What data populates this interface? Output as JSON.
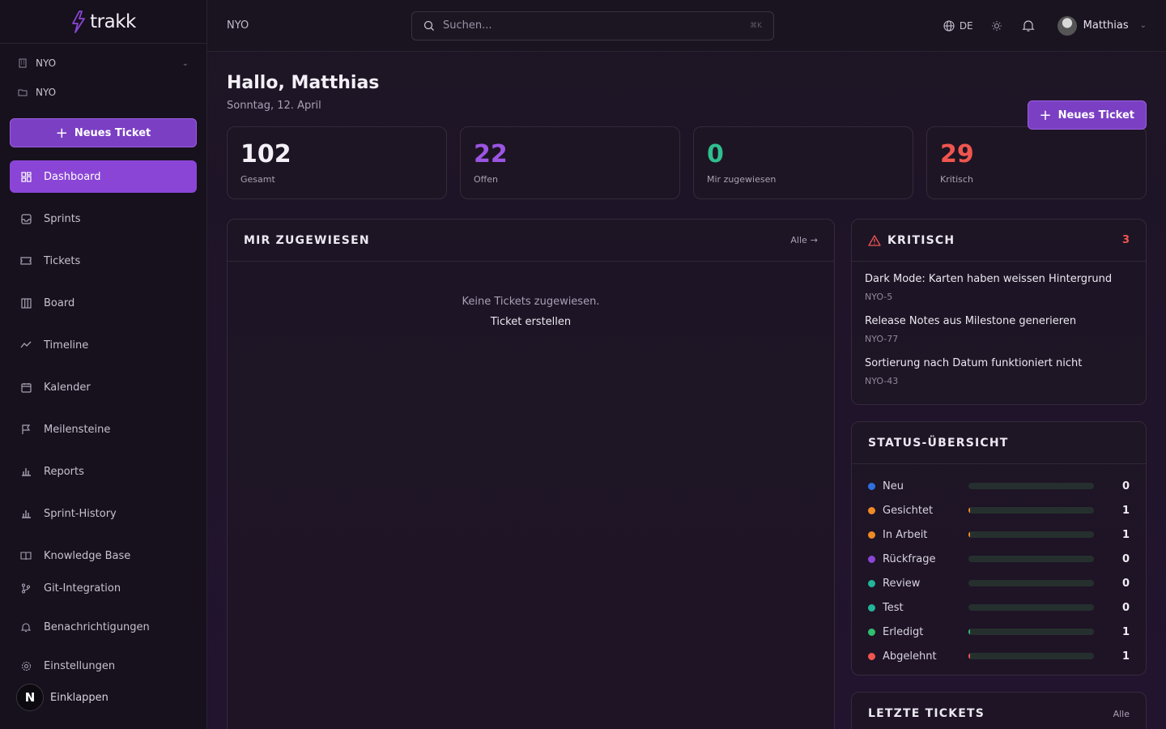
{
  "sidebar": {
    "logo": "trakk",
    "workspace": "NYO",
    "project": "NYO",
    "new_ticket": "Neues Ticket",
    "items": [
      {
        "label": "Dashboard",
        "icon": "dashboard-icon",
        "active": true
      },
      {
        "label": "Sprints",
        "icon": "sprints-icon"
      },
      {
        "label": "Tickets",
        "icon": "tickets-icon"
      },
      {
        "label": "Board",
        "icon": "board-icon"
      },
      {
        "label": "Timeline",
        "icon": "timeline-icon"
      },
      {
        "label": "Kalender",
        "icon": "calendar-icon"
      },
      {
        "label": "Meilensteine",
        "icon": "flag-icon"
      },
      {
        "label": "Reports",
        "icon": "chart-icon"
      },
      {
        "label": "Sprint-History",
        "icon": "chart-icon"
      },
      {
        "label": "Knowledge Base",
        "icon": "book-icon"
      },
      {
        "label": "Git-Integration",
        "icon": "git-icon"
      },
      {
        "label": "Benachrichtigungen",
        "icon": "bell-icon"
      },
      {
        "label": "Einstellungen",
        "icon": "gear-icon"
      }
    ],
    "collapse": "Einklappen",
    "avatar_letter": "N"
  },
  "topbar": {
    "breadcrumb": "NYO",
    "search_placeholder": "Suchen...",
    "shortcut": "⌘K",
    "language": "DE",
    "user": "Matthias"
  },
  "greeting": {
    "title": "Hallo, Matthias",
    "date": "Sonntag, 12. April",
    "new_ticket": "Neues Ticket"
  },
  "stats": [
    {
      "value": "102",
      "label": "Gesamt",
      "color": "#f4f0f8"
    },
    {
      "value": "22",
      "label": "Offen",
      "color": "#9b55e3"
    },
    {
      "value": "0",
      "label": "Mir zugewiesen",
      "color": "#2fbf8f"
    },
    {
      "value": "29",
      "label": "Kritisch",
      "color": "#f0554f"
    }
  ],
  "assigned": {
    "title": "MIR ZUGEWIESEN",
    "all": "Alle",
    "empty": "Keine Tickets zugewiesen.",
    "create": "Ticket erstellen"
  },
  "critical": {
    "title": "KRITISCH",
    "count": "3",
    "items": [
      {
        "title": "Dark Mode: Karten haben weissen Hintergrund",
        "key": "NYO-5"
      },
      {
        "title": "Release Notes aus Milestone generieren",
        "key": "NYO-77"
      },
      {
        "title": "Sortierung nach Datum funktioniert nicht",
        "key": "NYO-43"
      }
    ]
  },
  "status": {
    "title": "STATUS-ÜBERSICHT",
    "rows": [
      {
        "name": "Neu",
        "count": "0",
        "color": "#2f6fe0",
        "fill": 0
      },
      {
        "name": "Gesichtet",
        "count": "1",
        "color": "#f08a24",
        "fill": 0.01
      },
      {
        "name": "In Arbeit",
        "count": "1",
        "color": "#f08a24",
        "fill": 0.01
      },
      {
        "name": "Rückfrage",
        "count": "0",
        "color": "#8a45d6",
        "fill": 0
      },
      {
        "name": "Review",
        "count": "0",
        "color": "#22b59a",
        "fill": 0
      },
      {
        "name": "Test",
        "count": "0",
        "color": "#22b59a",
        "fill": 0
      },
      {
        "name": "Erledigt",
        "count": "1",
        "color": "#2fbf6f",
        "fill": 0.01
      },
      {
        "name": "Abgelehnt",
        "count": "1",
        "color": "#f0554f",
        "fill": 0.01
      }
    ]
  },
  "last_tickets": {
    "title": "LETZTE TICKETS",
    "all": "Alle"
  }
}
